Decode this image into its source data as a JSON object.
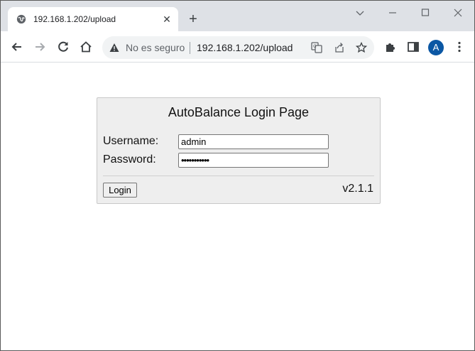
{
  "browser": {
    "tab_title": "192.168.1.202/upload",
    "tab_close_glyph": "✕",
    "new_tab_glyph": "+",
    "window_controls": {
      "minimize": "—",
      "maximize": "☐",
      "close": "✕",
      "tab_search": "⌄"
    },
    "omnibox": {
      "security_text": "No es seguro",
      "url": "192.168.1.202/upload"
    },
    "profile_initial": "A",
    "icons": [
      "back-arrow-icon",
      "forward-arrow-icon",
      "reload-icon",
      "home-icon",
      "warning-icon",
      "translate-icon",
      "share-icon",
      "star-icon",
      "extensions-icon",
      "side-panel-icon",
      "more-vert-icon"
    ],
    "accent_color": "#0b57a4"
  },
  "login": {
    "title": "AutoBalance Login Page",
    "username_label": "Username:",
    "username_value": "admin",
    "password_label": "Password:",
    "password_value": "•••••••••••",
    "login_button": "Login",
    "version": "v2.1.1"
  }
}
